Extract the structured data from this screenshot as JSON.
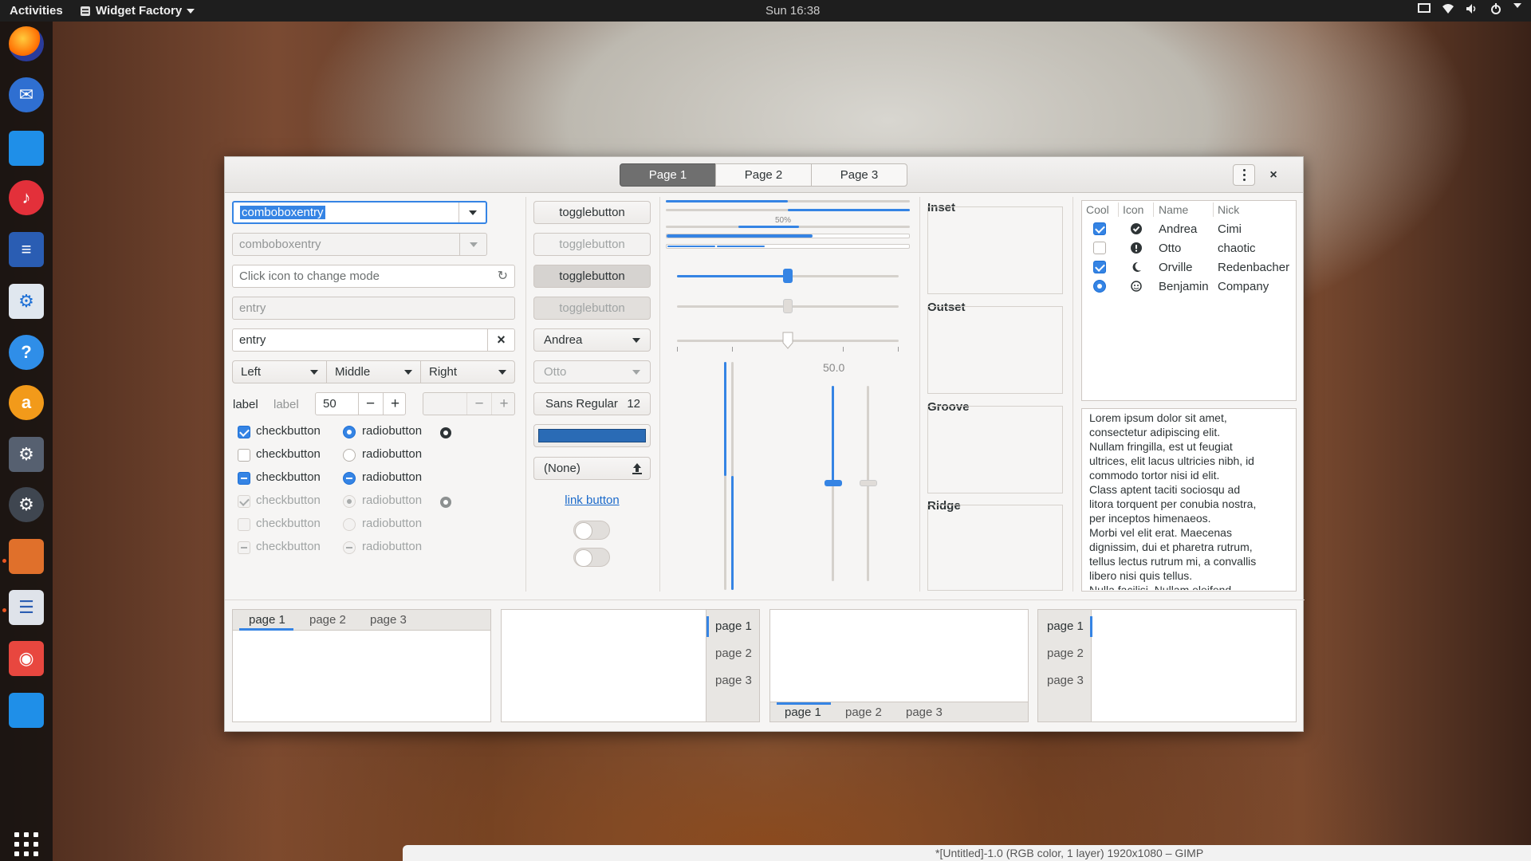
{
  "topbar": {
    "activities": "Activities",
    "app_menu": "Widget Factory",
    "clock": "Sun 16:38",
    "tray_icons": [
      "screen-icon",
      "network-icon",
      "volume-icon",
      "power-icon"
    ]
  },
  "dock": {
    "apps": [
      "Firefox",
      "Thunderbird",
      "Files",
      "Rhythmbox",
      "LibreOffice Writer",
      "Ubuntu Software",
      "Help",
      "Amazon",
      "Software Updater",
      "System Settings",
      "GIMP",
      "Widget Factory",
      "Screenshot",
      "Notes"
    ]
  },
  "gimp_bar": {
    "title": "*[Untitled]-1.0 (RGB color, 1 layer) 1920x1080 – GIMP"
  },
  "window": {
    "pages": [
      "Page 1",
      "Page 2",
      "Page 3"
    ],
    "active_page": "Page 1",
    "close": "×"
  },
  "col1": {
    "combo1": "comboboxentry",
    "combo2": "comboboxentry",
    "entry_placeholder": "Click icon to change mode",
    "entry_disabled": "entry",
    "entry_value": "entry",
    "clear_icon": "×",
    "segments": [
      "Left",
      "Middle",
      "Right"
    ],
    "label1": "label",
    "label2": "label",
    "spin_value": "50",
    "minus": "−",
    "plus": "+",
    "checks": [
      {
        "label": "checkbutton",
        "state": "checked"
      },
      {
        "label": "checkbutton",
        "state": "unchecked"
      },
      {
        "label": "checkbutton",
        "state": "mixed"
      },
      {
        "label": "checkbutton",
        "state": "checked-disabled"
      },
      {
        "label": "checkbutton",
        "state": "unchecked-disabled"
      },
      {
        "label": "checkbutton",
        "state": "mixed-disabled"
      }
    ],
    "radios": [
      {
        "label": "radiobutton",
        "state": "checked"
      },
      {
        "label": "radiobutton",
        "state": "unchecked"
      },
      {
        "label": "radiobutton",
        "state": "mixed"
      },
      {
        "label": "radiobutton",
        "state": "checked-disabled"
      },
      {
        "label": "radiobutton",
        "state": "unchecked-disabled"
      },
      {
        "label": "radiobutton",
        "state": "mixed-disabled"
      }
    ]
  },
  "col2": {
    "toggle1": "togglebutton",
    "toggle2": "togglebutton",
    "toggle3": "togglebutton",
    "toggle4": "togglebutton",
    "combo_andrea": "Andrea",
    "combo_otto": "Otto",
    "font_name": "Sans Regular",
    "font_size": "12",
    "color_value": "#2a6bb5",
    "file_none": "(None)",
    "link": "link button",
    "switch1": "off",
    "switch2": "off"
  },
  "col3": {
    "progress_label": "50%",
    "progress_value": 0.5,
    "scale_value": "50.0",
    "scale_fraction": 0.5
  },
  "frames": [
    "Inset",
    "Outset",
    "Groove",
    "Ridge"
  ],
  "treeview": {
    "columns": [
      "Cool",
      "Icon",
      "Name",
      "Nick"
    ],
    "rows": [
      {
        "cool": "checked",
        "icon": "check-circle-icon",
        "name": "Andrea",
        "nick": "Cimi"
      },
      {
        "cool": "unchecked",
        "icon": "warning-circle-icon",
        "name": "Otto",
        "nick": "chaotic"
      },
      {
        "cool": "checked",
        "icon": "moon-icon",
        "name": "Orville",
        "nick": "Redenbacher"
      },
      {
        "cool": "radio",
        "icon": "face-icon",
        "name": "Benjamin",
        "nick": "Company"
      }
    ]
  },
  "lorem": [
    "Lorem ipsum dolor sit amet,",
    "consectetur adipiscing elit.",
    "Nullam fringilla, est ut feugiat",
    "ultrices, elit lacus ultricies nibh, id",
    "commodo tortor nisi id elit.",
    "Class aptent taciti sociosqu ad",
    "litora torquent per conubia nostra,",
    "per inceptos himenaeos.",
    "Morbi vel elit erat. Maecenas",
    "dignissim, dui et pharetra rutrum,",
    "tellus lectus rutrum mi, a convallis",
    "libero nisi quis tellus.",
    "Nulla facilisi. Nullam eleifend"
  ],
  "notebooks": {
    "tabs": [
      "page 1",
      "page 2",
      "page 3"
    ]
  },
  "colors": {
    "accent": "#3584e4",
    "headerbar_active": "#6f6f6f"
  }
}
